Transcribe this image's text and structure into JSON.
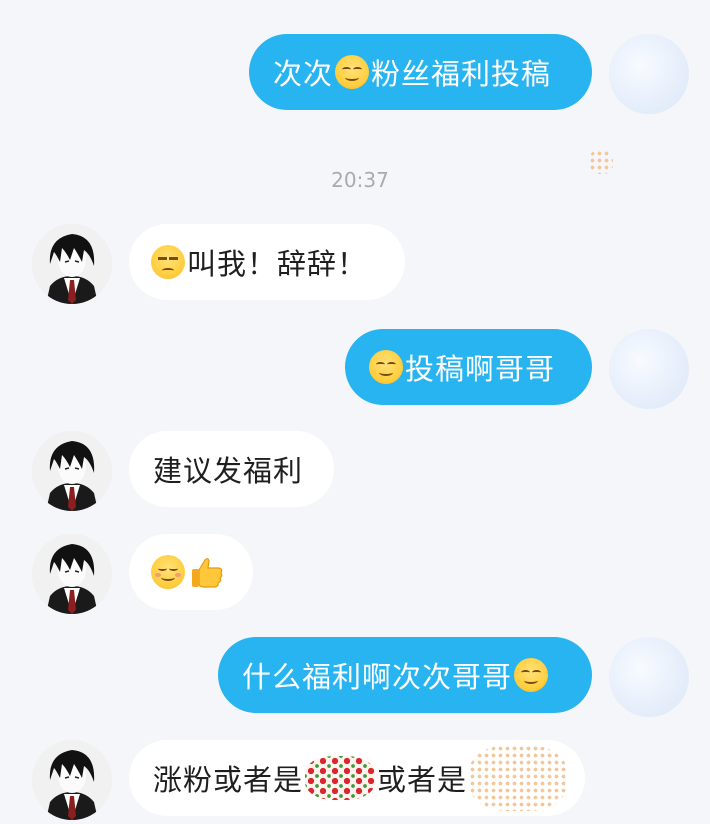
{
  "timestamp": "20:37",
  "messages": [
    {
      "side": "right",
      "before": "次次",
      "emoji_mid": "relieved-face-emoji",
      "after": "粉丝福利投稿"
    },
    {
      "side": "left",
      "emoji_start": "unamused-face-emoji",
      "text": "叫我！辞辞！"
    },
    {
      "side": "right",
      "emoji_start": "relieved-face-emoji",
      "text": "投稿啊哥哥"
    },
    {
      "side": "left",
      "text": "建议发福利"
    },
    {
      "side": "left",
      "emoji": [
        "smiling-face-emoji",
        "thumbs-up-emoji"
      ]
    },
    {
      "side": "right",
      "text": "什么福利啊次次哥哥",
      "emoji_end": "relieved-face-emoji"
    },
    {
      "side": "left",
      "part1": "涨粉或者是",
      "part2": "或者是"
    }
  ],
  "colors": {
    "outgoing_bubble": "#27b4f0",
    "incoming_bubble": "#ffffff",
    "background": "#f4f6f9"
  }
}
